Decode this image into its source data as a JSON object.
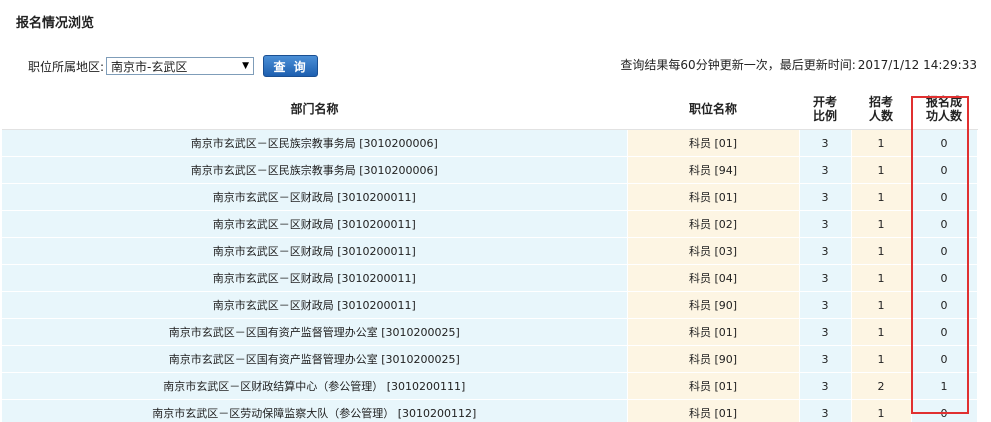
{
  "page_title": "报名情况浏览",
  "filter": {
    "label": "职位所属地区:",
    "selected": "南京市-玄武区",
    "query_button": "查 询"
  },
  "update_info": {
    "text": "查询结果每60分钟更新一次，最后更新时间:",
    "time": "2017/1/12 14:29:33"
  },
  "table": {
    "headers": {
      "dept": "部门名称",
      "position": "职位名称",
      "ratio": "开考\n比例",
      "quota": "招考\n人数",
      "success": "报名成\n功人数"
    },
    "rows": [
      {
        "dept": "南京市玄武区－区民族宗教事务局 [3010200006]",
        "position": "科员 [01]",
        "ratio": "3",
        "quota": "1",
        "success": "0"
      },
      {
        "dept": "南京市玄武区－区民族宗教事务局 [3010200006]",
        "position": "科员 [94]",
        "ratio": "3",
        "quota": "1",
        "success": "0"
      },
      {
        "dept": "南京市玄武区－区财政局 [3010200011]",
        "position": "科员 [01]",
        "ratio": "3",
        "quota": "1",
        "success": "0"
      },
      {
        "dept": "南京市玄武区－区财政局 [3010200011]",
        "position": "科员 [02]",
        "ratio": "3",
        "quota": "1",
        "success": "0"
      },
      {
        "dept": "南京市玄武区－区财政局 [3010200011]",
        "position": "科员 [03]",
        "ratio": "3",
        "quota": "1",
        "success": "0"
      },
      {
        "dept": "南京市玄武区－区财政局 [3010200011]",
        "position": "科员 [04]",
        "ratio": "3",
        "quota": "1",
        "success": "0"
      },
      {
        "dept": "南京市玄武区－区财政局 [3010200011]",
        "position": "科员 [90]",
        "ratio": "3",
        "quota": "1",
        "success": "0"
      },
      {
        "dept": "南京市玄武区－区国有资产监督管理办公室 [3010200025]",
        "position": "科员 [01]",
        "ratio": "3",
        "quota": "1",
        "success": "0"
      },
      {
        "dept": "南京市玄武区－区国有资产监督管理办公室 [3010200025]",
        "position": "科员 [90]",
        "ratio": "3",
        "quota": "1",
        "success": "0"
      },
      {
        "dept": "南京市玄武区－区财政结算中心（参公管理） [3010200111]",
        "position": "科员 [01]",
        "ratio": "3",
        "quota": "2",
        "success": "1"
      },
      {
        "dept": "南京市玄武区－区劳动保障监察大队（参公管理） [3010200112]",
        "position": "科员 [01]",
        "ratio": "3",
        "quota": "1",
        "success": "0"
      }
    ]
  },
  "colors": {
    "row_blue": "#e8f6fb",
    "row_cream": "#fdf5e3",
    "button": "#2a6ec2",
    "highlight": "#e03030"
  },
  "icons": {
    "select_arrow": "dropdown-arrow-icon"
  }
}
